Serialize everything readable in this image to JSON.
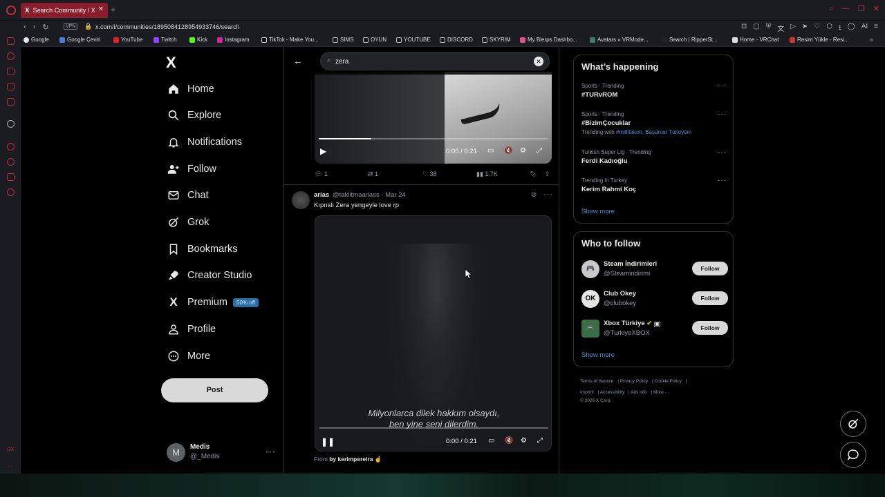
{
  "browser": {
    "tab_title": "Search Community / X",
    "url": "x.com/i/communities/1895084128954933746/search",
    "vpn_label": "VPN",
    "bookmarks": [
      "Google",
      "Google Çeviri",
      "YouTube",
      "Twitch",
      "Kick",
      "Instagram",
      "TikTok - Make You...",
      "SIMS",
      "OYUN",
      "YOUTUBE",
      "DISCORD",
      "SKYRIM",
      "My Blerps Dashbo...",
      "Avatars » VRMode...",
      "Search | RipperSt...",
      "Home - VRChat",
      "Resim Yükle - Resi..."
    ],
    "ai_label": "AI"
  },
  "sidebar": {
    "logo": "X",
    "items": [
      {
        "label": "Home",
        "icon": "⌂"
      },
      {
        "label": "Explore",
        "icon": "⌕"
      },
      {
        "label": "Notifications",
        "icon": "🔔"
      },
      {
        "label": "Follow",
        "icon": "👤"
      },
      {
        "label": "Chat",
        "icon": "✉"
      },
      {
        "label": "Grok",
        "icon": "⊘"
      },
      {
        "label": "Bookmarks",
        "icon": "🔖"
      },
      {
        "label": "Creator Studio",
        "icon": "🚀"
      },
      {
        "label": "Premium",
        "icon": "X"
      },
      {
        "label": "Profile",
        "icon": "👤"
      },
      {
        "label": "More",
        "icon": "⋯"
      }
    ],
    "premium_badge": "50% off",
    "post_button": "Post",
    "account": {
      "initial": "M",
      "name": "Medis",
      "handle": "@_Medis"
    }
  },
  "feed": {
    "search_value": "zera",
    "post1": {
      "time": "0:05 / 0:21",
      "progress": 0.23,
      "replies": "1",
      "reposts": "1",
      "likes": "38",
      "views": "1.7K"
    },
    "post2": {
      "name": "arias",
      "handle": "@taklitmaarlass · Mar 24",
      "text": "Kıpnslı Zera  yengeyle love rp",
      "subtitle_line1": "Milyonlarca dilek hakkım olsaydı,",
      "subtitle_line2": "ben yine seni dilerdim.",
      "time": "0:00 / 0:21",
      "from_prefix": "From",
      "from_user": "by kerimpereira",
      "from_emoji": "☝"
    }
  },
  "happening": {
    "title": "What’s happening",
    "trends": [
      {
        "meta": "Sports · Trending",
        "name": "#TURvROM"
      },
      {
        "meta": "Sports · Trending",
        "name": "#BizimÇocuklar",
        "with_prefix": "Trending with",
        "with_links": "#millitakım, Başarılar Türkiyem"
      },
      {
        "meta": "Turkish Super Lig · Trending",
        "name": "Ferdi Kadıoğlu"
      },
      {
        "meta": "Trending in Turkey",
        "name": "Kerim Rahmi Koç"
      }
    ],
    "show_more": "Show more"
  },
  "who_to_follow": {
    "title": "Who to follow",
    "users": [
      {
        "name": "Steam İndirimleri",
        "handle": "@Steamindirimi",
        "avatar": "🎮",
        "button": "Follow"
      },
      {
        "name": "Club Okey",
        "handle": "@clubokey",
        "avatar": "OK",
        "button": "Follow"
      },
      {
        "name": "Xbox Türkiye",
        "handle": "@TurkiyeXBOX",
        "avatar": "🎮",
        "button": "Follow"
      }
    ],
    "show_more": "Show more"
  },
  "footer": [
    "Terms of Service",
    "Privacy Policy",
    "Cookie Policy",
    "Imprint",
    "Accessibility",
    "Ads info",
    "More ···",
    "© 2026 X Corp."
  ]
}
